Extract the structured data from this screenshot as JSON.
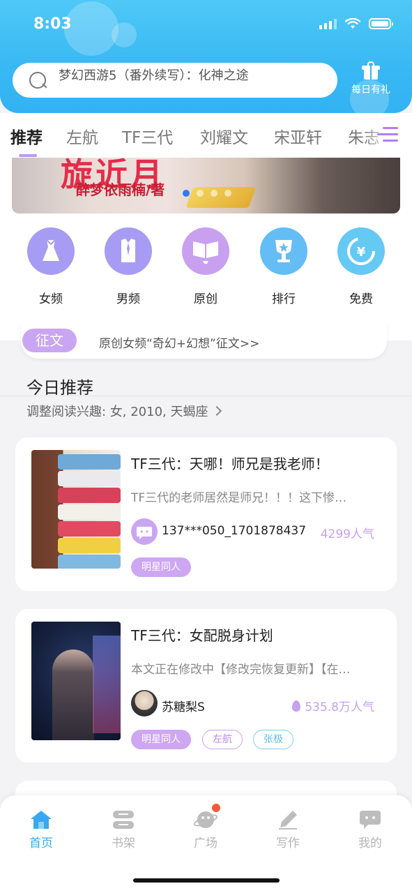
{
  "status_bar": {
    "time": "8:03"
  },
  "search": {
    "placeholder": "梦幻西游5（番外续写）：化神之途"
  },
  "gift": {
    "label": "每日有礼"
  },
  "tabs": [
    {
      "label": "推荐",
      "active": true
    },
    {
      "label": "左航"
    },
    {
      "label": "TF三代"
    },
    {
      "label": "刘耀文"
    },
    {
      "label": "宋亚轩"
    },
    {
      "label": "朱志"
    }
  ],
  "banner": {
    "title": "旋近月",
    "author": "醉梦依雨楠/著",
    "dots": 4,
    "active_dot": 0
  },
  "categories": [
    {
      "label": "女频",
      "icon": "dress-icon",
      "color": "#a79cf3"
    },
    {
      "label": "男频",
      "icon": "shirt-icon",
      "color": "#a79cf3"
    },
    {
      "label": "原创",
      "icon": "book-icon",
      "color": "#c9a0f0"
    },
    {
      "label": "排行",
      "icon": "trophy-icon",
      "color": "#64bdf5"
    },
    {
      "label": "免费",
      "icon": "yen-icon",
      "color": "#64c9f3"
    }
  ],
  "notice": {
    "chip": "征文",
    "text": "原创女频“奇幻+幻想”征文>>"
  },
  "section": {
    "title": "今日推荐",
    "subtitle": "调整阅读兴趣: 女, 2010, 天蝎座"
  },
  "cards": [
    {
      "title": "TF三代：天哪！师兄是我老师！",
      "desc": "TF三代的老师居然是师兄！！！这下惨…",
      "author": "137***050_1701878437",
      "popularity": "4299人气",
      "tags": [
        {
          "label": "明星同人",
          "style": "fill"
        }
      ]
    },
    {
      "title": "TF三代：女配脱身计划",
      "desc": "本文正在修改中【修改完恢复更新】【在…",
      "author": "苏糖梨S",
      "popularity": "535.8万人气",
      "tags": [
        {
          "label": "明星同人",
          "style": "fill"
        },
        {
          "label": "左航",
          "style": "outline-purple"
        },
        {
          "label": "张极",
          "style": "outline-blue"
        }
      ]
    }
  ],
  "bottom_nav": [
    {
      "label": "首页",
      "icon": "home-icon",
      "active": true
    },
    {
      "label": "书架",
      "icon": "bookshelf-icon"
    },
    {
      "label": "广场",
      "icon": "planet-icon",
      "badge": true
    },
    {
      "label": "写作",
      "icon": "pen-icon"
    },
    {
      "label": "我的",
      "icon": "chat-bubble-icon"
    }
  ],
  "colors": {
    "header": "#3bb9f3",
    "accent_purple": "#c9a6f2",
    "accent_blue": "#3aa8f0"
  }
}
